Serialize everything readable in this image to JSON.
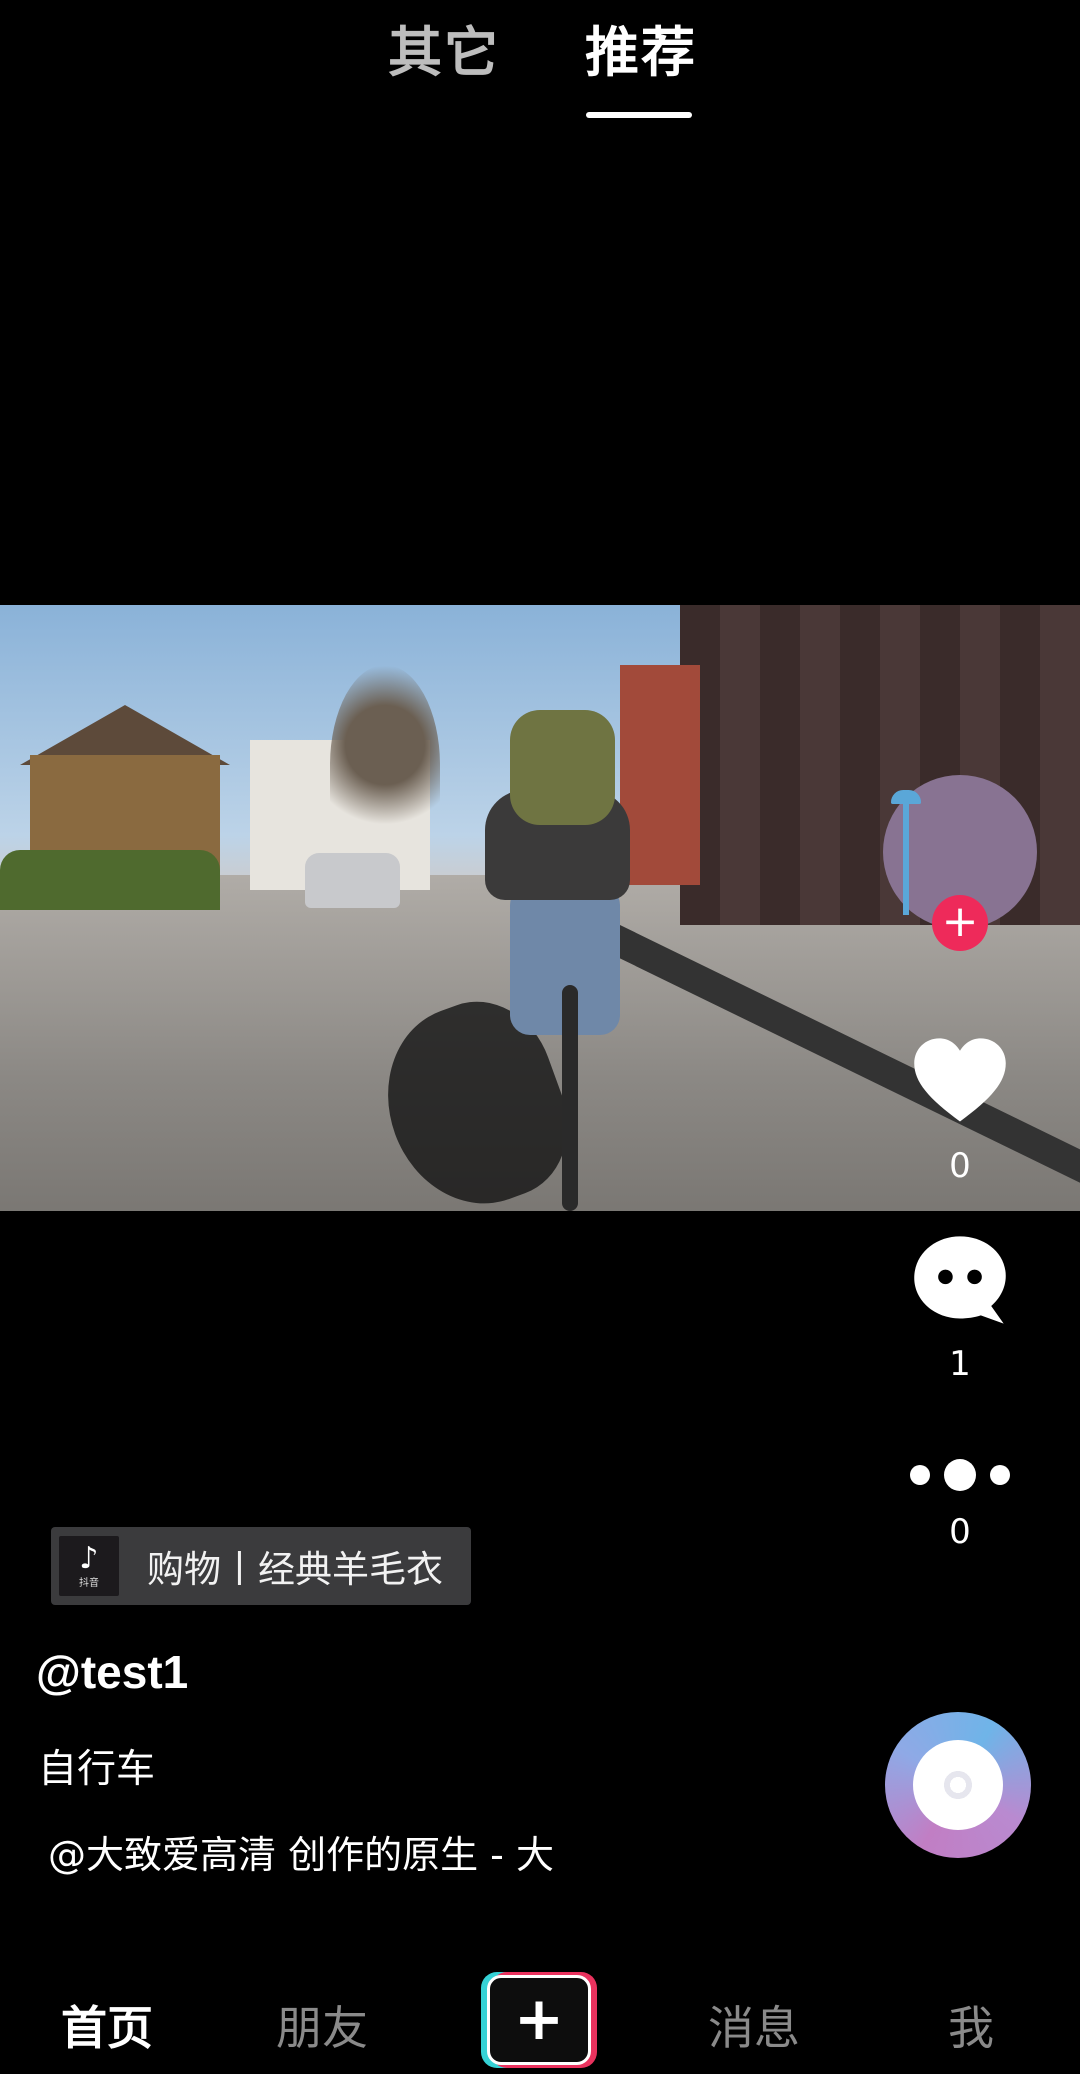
{
  "top_tabs": {
    "other": "其它",
    "recommended": "推荐",
    "active": "推荐"
  },
  "shop_tag": {
    "label": "购物丨经典羊毛衣",
    "logo_text": "抖音"
  },
  "video": {
    "author": "@test1",
    "caption": "自行车",
    "music_text": "@大致爱高清 创作的原生 - 大"
  },
  "actions": {
    "follow_symbol": "+",
    "like_count": "0",
    "comment_count": "1",
    "share_count": "0"
  },
  "bottom_nav": {
    "home": "首页",
    "friends": "朋友",
    "add_symbol": "+",
    "messages": "消息",
    "me": "我"
  },
  "colors": {
    "follow_red": "#ee2a5a",
    "add_cyan": "#35d2d6",
    "add_pink": "#e9325e",
    "inactive_gray": "#8a8a8a"
  },
  "icons": [
    "heart-icon",
    "comment-bubble-icon",
    "more-dots-icon",
    "music-disc-icon",
    "tiktok-logo-icon",
    "plus-icon"
  ]
}
